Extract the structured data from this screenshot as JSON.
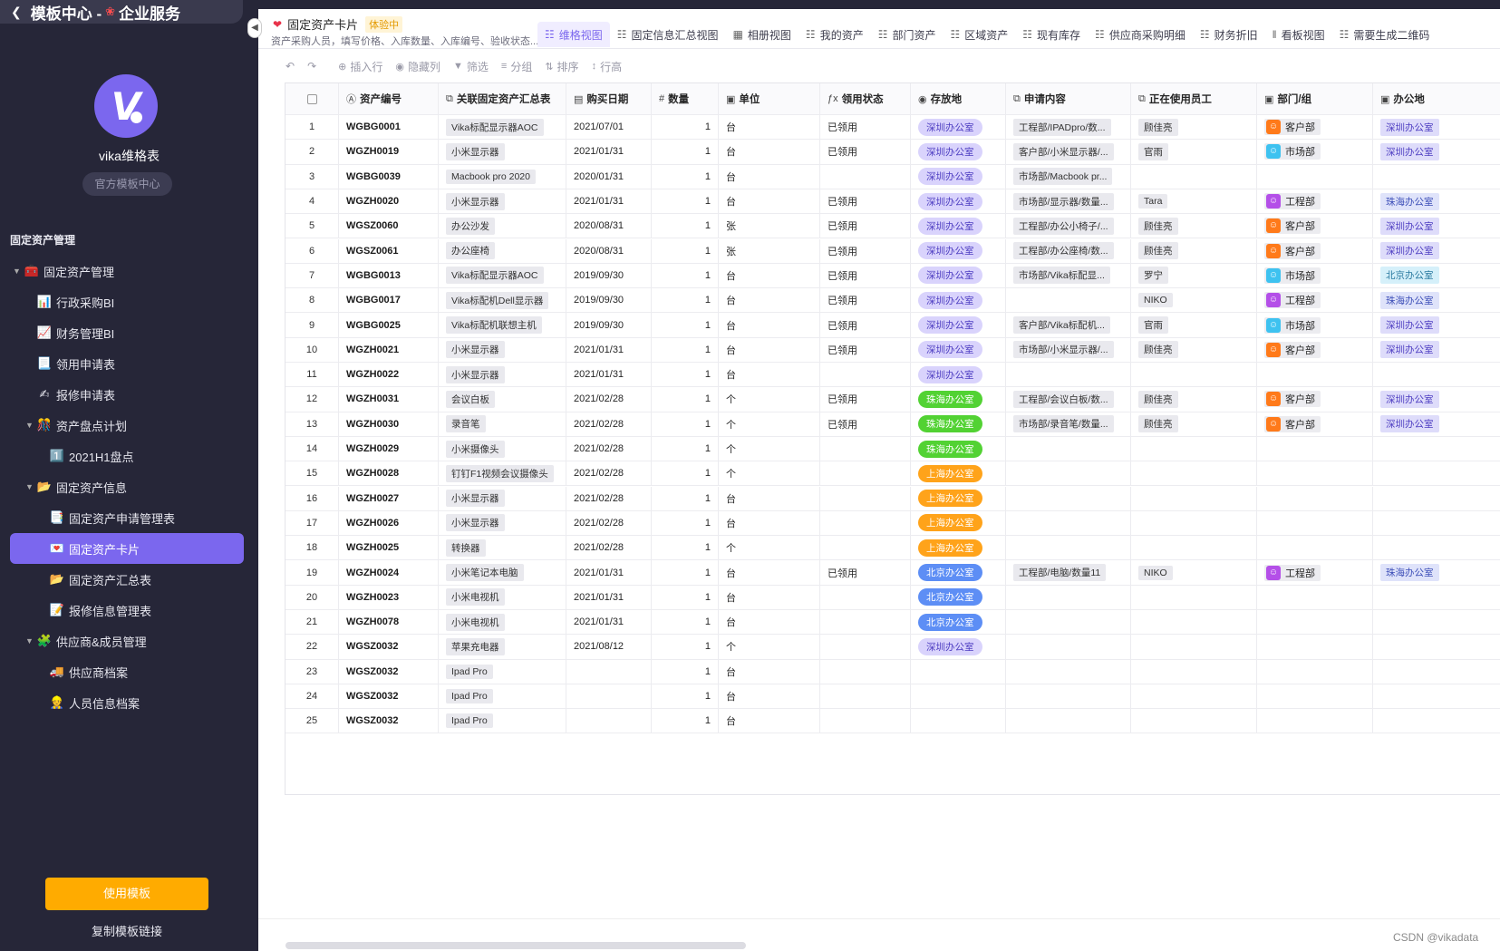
{
  "sidebar": {
    "header": {
      "prefix": "模板中心 -",
      "suffix": "企业服务"
    },
    "app_name": "vika维格表",
    "badge": "官方模板中心",
    "section_title": "固定资产管理",
    "nav": [
      {
        "label": "固定资产管理",
        "icon": "toolbox-icon",
        "glyph": "🧰",
        "level": 0,
        "caret": true
      },
      {
        "label": "行政采购BI",
        "icon": "bar-chart-icon",
        "glyph": "📊",
        "level": 1,
        "caret": false
      },
      {
        "label": "财务管理BI",
        "icon": "line-chart-icon",
        "glyph": "📈",
        "level": 1,
        "caret": false
      },
      {
        "label": "领用申请表",
        "icon": "scroll-icon",
        "glyph": "📃",
        "level": 1,
        "caret": false
      },
      {
        "label": "报修申请表",
        "icon": "writing-hand-icon",
        "glyph": "✍",
        "level": 1,
        "caret": false
      },
      {
        "label": "资产盘点计划",
        "icon": "puzzle-party-icon",
        "glyph": "🎊",
        "level": 1,
        "caret": true
      },
      {
        "label": "2021H1盘点",
        "icon": "keycap-one-icon",
        "glyph": "1️⃣",
        "level": 2,
        "caret": false
      },
      {
        "label": "固定资产信息",
        "icon": "folder-icon",
        "glyph": "📂",
        "level": 1,
        "caret": true
      },
      {
        "label": "固定资产申请管理表",
        "icon": "document-icon",
        "glyph": "📑",
        "level": 2,
        "caret": false
      },
      {
        "label": "固定资产卡片",
        "icon": "heart-card-icon",
        "glyph": "💌",
        "level": 2,
        "caret": false,
        "active": true
      },
      {
        "label": "固定资产汇总表",
        "icon": "open-folder-icon",
        "glyph": "📂",
        "level": 2,
        "caret": false
      },
      {
        "label": "报修信息管理表",
        "icon": "memo-icon",
        "glyph": "📝",
        "level": 2,
        "caret": false
      },
      {
        "label": "供应商&成员管理",
        "icon": "puzzle-icon",
        "glyph": "🧩",
        "level": 1,
        "caret": true
      },
      {
        "label": "供应商档案",
        "icon": "truck-icon",
        "glyph": "🚚",
        "level": 2,
        "caret": false
      },
      {
        "label": "人员信息档案",
        "icon": "person-icon",
        "glyph": "👷",
        "level": 2,
        "caret": false
      }
    ],
    "use_button": "使用模板",
    "copy_link": "复制模板链接"
  },
  "sheet": {
    "title": "固定资产卡片",
    "trial": "体验中",
    "desc": "资产采购人员，填写价格、入库数量、入库编号、验收状态..."
  },
  "views": [
    {
      "label": "维格视图",
      "icon": "grid-view-icon",
      "active": true
    },
    {
      "label": "固定信息汇总视图",
      "icon": "grid-view-icon"
    },
    {
      "label": "相册视图",
      "icon": "gallery-view-icon"
    },
    {
      "label": "我的资产",
      "icon": "grid-view-icon"
    },
    {
      "label": "部门资产",
      "icon": "grid-view-icon"
    },
    {
      "label": "区域资产",
      "icon": "grid-view-icon"
    },
    {
      "label": "现有库存",
      "icon": "grid-view-icon"
    },
    {
      "label": "供应商采购明细",
      "icon": "grid-view-icon"
    },
    {
      "label": "财务折旧",
      "icon": "grid-view-icon"
    },
    {
      "label": "看板视图",
      "icon": "kanban-view-icon"
    },
    {
      "label": "需要生成二维码",
      "icon": "grid-view-icon"
    }
  ],
  "toolbar": {
    "undo": "undo-icon",
    "redo": "redo-icon",
    "items": [
      {
        "label": "插入行",
        "icon": "plus-circle-icon"
      },
      {
        "label": "隐藏列",
        "icon": "eye-icon"
      },
      {
        "label": "筛选",
        "icon": "filter-icon"
      },
      {
        "label": "分组",
        "icon": "group-icon"
      },
      {
        "label": "排序",
        "icon": "sort-icon"
      },
      {
        "label": "行高",
        "icon": "row-height-icon"
      }
    ]
  },
  "columns": [
    {
      "key": "code",
      "label": "资产编号",
      "icon": "text-field-icon"
    },
    {
      "key": "asset",
      "label": "关联固定资产汇总表",
      "icon": "link-field-icon"
    },
    {
      "key": "date",
      "label": "购买日期",
      "icon": "date-field-icon"
    },
    {
      "key": "qty",
      "label": "数量",
      "icon": "number-field-icon"
    },
    {
      "key": "unit",
      "label": "单位",
      "icon": "lookup-field-icon"
    },
    {
      "key": "status",
      "label": "领用状态",
      "icon": "formula-field-icon"
    },
    {
      "key": "place",
      "label": "存放地",
      "icon": "select-field-icon"
    },
    {
      "key": "req",
      "label": "申请内容",
      "icon": "link-field-icon"
    },
    {
      "key": "user",
      "label": "正在使用员工",
      "icon": "link-field-icon"
    },
    {
      "key": "dept",
      "label": "部门/组",
      "icon": "lookup-field-icon"
    },
    {
      "key": "office",
      "label": "办公地",
      "icon": "lookup-field-icon"
    }
  ],
  "rows": [
    {
      "n": "1",
      "code": "WGBG0001",
      "asset": "Vika标配显示器AOC",
      "date": "2021/07/01",
      "qty": "1",
      "unit": "台",
      "status": "已领用",
      "place": "深圳办公室",
      "req": "工程部/IPADpro/数...",
      "user": "顾佳亮",
      "dept": "客户部",
      "office": "深圳办公室"
    },
    {
      "n": "2",
      "code": "WGZH0019",
      "asset": "小米显示器",
      "date": "2021/01/31",
      "qty": "1",
      "unit": "台",
      "status": "已领用",
      "place": "深圳办公室",
      "req": "客户部/小米显示器/...",
      "user": "官雨",
      "dept": "市场部",
      "office": "深圳办公室"
    },
    {
      "n": "3",
      "code": "WGBG0039",
      "asset": "Macbook pro 2020",
      "date": "2020/01/31",
      "qty": "1",
      "unit": "台",
      "status": "",
      "place": "深圳办公室",
      "req": "市场部/Macbook pr...",
      "user": "",
      "dept": "",
      "office": ""
    },
    {
      "n": "4",
      "code": "WGZH0020",
      "asset": "小米显示器",
      "date": "2021/01/31",
      "qty": "1",
      "unit": "台",
      "status": "已领用",
      "place": "深圳办公室",
      "req": "市场部/显示器/数量...",
      "user": "Tara",
      "dept": "工程部",
      "office": "珠海办公室"
    },
    {
      "n": "5",
      "code": "WGSZ0060",
      "asset": "办公沙发",
      "date": "2020/08/31",
      "qty": "1",
      "unit": "张",
      "status": "已领用",
      "place": "深圳办公室",
      "req": "工程部/办公小椅子/...",
      "user": "顾佳亮",
      "dept": "客户部",
      "office": "深圳办公室"
    },
    {
      "n": "6",
      "code": "WGSZ0061",
      "asset": "办公座椅",
      "date": "2020/08/31",
      "qty": "1",
      "unit": "张",
      "status": "已领用",
      "place": "深圳办公室",
      "req": "工程部/办公座椅/数...",
      "user": "顾佳亮",
      "dept": "客户部",
      "office": "深圳办公室"
    },
    {
      "n": "7",
      "code": "WGBG0013",
      "asset": "Vika标配显示器AOC",
      "date": "2019/09/30",
      "qty": "1",
      "unit": "台",
      "status": "已领用",
      "place": "深圳办公室",
      "req": "市场部/Vika标配显...",
      "user": "罗宁",
      "dept": "市场部",
      "office": "北京办公室"
    },
    {
      "n": "8",
      "code": "WGBG0017",
      "asset": "Vika标配机Dell显示器",
      "date": "2019/09/30",
      "qty": "1",
      "unit": "台",
      "status": "已领用",
      "place": "深圳办公室",
      "req": "",
      "user": "NIKO",
      "dept": "工程部",
      "office": "珠海办公室"
    },
    {
      "n": "9",
      "code": "WGBG0025",
      "asset": "Vika标配机联想主机",
      "date": "2019/09/30",
      "qty": "1",
      "unit": "台",
      "status": "已领用",
      "place": "深圳办公室",
      "req": "客户部/Vika标配机...",
      "user": "官雨",
      "dept": "市场部",
      "office": "深圳办公室"
    },
    {
      "n": "10",
      "code": "WGZH0021",
      "asset": "小米显示器",
      "date": "2021/01/31",
      "qty": "1",
      "unit": "台",
      "status": "已领用",
      "place": "深圳办公室",
      "req": "市场部/小米显示器/...",
      "user": "顾佳亮",
      "dept": "客户部",
      "office": "深圳办公室"
    },
    {
      "n": "11",
      "code": "WGZH0022",
      "asset": "小米显示器",
      "date": "2021/01/31",
      "qty": "1",
      "unit": "台",
      "status": "",
      "place": "深圳办公室",
      "req": "",
      "user": "",
      "dept": "",
      "office": ""
    },
    {
      "n": "12",
      "code": "WGZH0031",
      "asset": "会议白板",
      "date": "2021/02/28",
      "qty": "1",
      "unit": "个",
      "status": "已领用",
      "place": "珠海办公室",
      "req": "工程部/会议白板/数...",
      "user": "顾佳亮",
      "dept": "客户部",
      "office": "深圳办公室"
    },
    {
      "n": "13",
      "code": "WGZH0030",
      "asset": "录音笔",
      "date": "2021/02/28",
      "qty": "1",
      "unit": "个",
      "status": "已领用",
      "place": "珠海办公室",
      "req": "市场部/录音笔/数量...",
      "user": "顾佳亮",
      "dept": "客户部",
      "office": "深圳办公室"
    },
    {
      "n": "14",
      "code": "WGZH0029",
      "asset": "小米摄像头",
      "date": "2021/02/28",
      "qty": "1",
      "unit": "个",
      "status": "",
      "place": "珠海办公室",
      "req": "",
      "user": "",
      "dept": "",
      "office": ""
    },
    {
      "n": "15",
      "code": "WGZH0028",
      "asset": "钉钉F1视频会议摄像头",
      "date": "2021/02/28",
      "qty": "1",
      "unit": "个",
      "status": "",
      "place": "上海办公室",
      "req": "",
      "user": "",
      "dept": "",
      "office": ""
    },
    {
      "n": "16",
      "code": "WGZH0027",
      "asset": "小米显示器",
      "date": "2021/02/28",
      "qty": "1",
      "unit": "台",
      "status": "",
      "place": "上海办公室",
      "req": "",
      "user": "",
      "dept": "",
      "office": ""
    },
    {
      "n": "17",
      "code": "WGZH0026",
      "asset": "小米显示器",
      "date": "2021/02/28",
      "qty": "1",
      "unit": "台",
      "status": "",
      "place": "上海办公室",
      "req": "",
      "user": "",
      "dept": "",
      "office": ""
    },
    {
      "n": "18",
      "code": "WGZH0025",
      "asset": "转换器",
      "date": "2021/02/28",
      "qty": "1",
      "unit": "个",
      "status": "",
      "place": "上海办公室",
      "req": "",
      "user": "",
      "dept": "",
      "office": ""
    },
    {
      "n": "19",
      "code": "WGZH0024",
      "asset": "小米笔记本电脑",
      "date": "2021/01/31",
      "qty": "1",
      "unit": "台",
      "status": "已领用",
      "place": "北京办公室",
      "req": "工程部/电脑/数量11",
      "user": "NIKO",
      "dept": "工程部",
      "office": "珠海办公室"
    },
    {
      "n": "20",
      "code": "WGZH0023",
      "asset": "小米电视机",
      "date": "2021/01/31",
      "qty": "1",
      "unit": "台",
      "status": "",
      "place": "北京办公室",
      "req": "",
      "user": "",
      "dept": "",
      "office": ""
    },
    {
      "n": "21",
      "code": "WGZH0078",
      "asset": "小米电视机",
      "date": "2021/01/31",
      "qty": "1",
      "unit": "台",
      "status": "",
      "place": "北京办公室",
      "req": "",
      "user": "",
      "dept": "",
      "office": ""
    },
    {
      "n": "22",
      "code": "WGSZ0032",
      "asset": "苹果充电器",
      "date": "2021/08/12",
      "qty": "1",
      "unit": "个",
      "status": "",
      "place": "深圳办公室",
      "req": "",
      "user": "",
      "dept": "",
      "office": ""
    },
    {
      "n": "23",
      "code": "WGSZ0032",
      "asset": "Ipad Pro",
      "date": "",
      "qty": "1",
      "unit": "台",
      "status": "",
      "place": "",
      "req": "",
      "user": "",
      "dept": "",
      "office": ""
    },
    {
      "n": "24",
      "code": "WGSZ0032",
      "asset": "Ipad Pro",
      "date": "",
      "qty": "1",
      "unit": "台",
      "status": "",
      "place": "",
      "req": "",
      "user": "",
      "dept": "",
      "office": ""
    },
    {
      "n": "25",
      "code": "WGSZ0032",
      "asset": "Ipad Pro",
      "date": "",
      "qty": "1",
      "unit": "台",
      "status": "",
      "place": "",
      "req": "",
      "user": "",
      "dept": "",
      "office": ""
    }
  ],
  "colors": {
    "sidebar_bg": "#262638",
    "accent": "#7b67ee",
    "use_button": "#ffab00",
    "place_shenzhen": "#d9d3fc",
    "place_zhuhai": "#52d233",
    "place_shanghai": "#ffa31a",
    "place_beijing": "#5d8ef5"
  },
  "watermark": "CSDN @vikadata"
}
